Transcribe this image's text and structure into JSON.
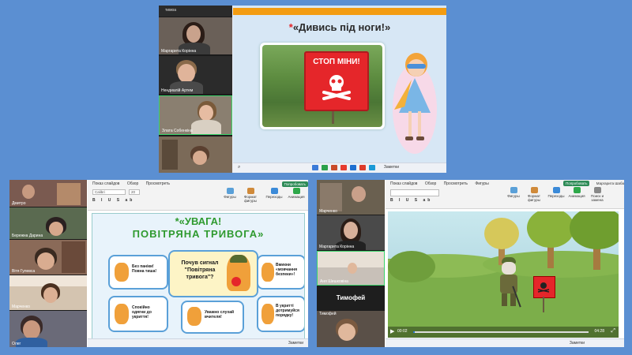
{
  "top_window": {
    "participants": [
      {
        "name": "Маргарита Корінна"
      },
      {
        "name": "Нендиалій Артем"
      },
      {
        "name": "Злата Собенкіна"
      },
      {
        "name": ""
      }
    ],
    "header_name": "тимоа",
    "slide": {
      "title_star": "*",
      "title": "«Дивись під ноги!»",
      "sign_text": "СТОП МІНИ!"
    },
    "notes_label": "Заметки",
    "colors": {
      "orange_bar": "#f39c12",
      "sign_red": "#e5262a"
    }
  },
  "bottom_left_window": {
    "participants": [
      {
        "name": "Дмитро"
      },
      {
        "name": "Бережна Дарина"
      },
      {
        "name": "Вітя Гулевса"
      },
      {
        "name": "Марченко"
      },
      {
        "name": "Олег"
      }
    ],
    "ribbon": {
      "menu": [
        "Показ слайдов",
        "Обзор",
        "Просмотреть"
      ],
      "tools": [
        "Фигуры",
        "Формат фигуры",
        "Переходы",
        "Анимация"
      ],
      "font": "Calibri",
      "font_size": "20",
      "badge": "Попробовать"
    },
    "slide": {
      "title_line1": "*«УВАГА!",
      "title_line2": "ПОВІТРЯНА ТРИВОГА»",
      "center_card": "Почув сигнал \"Повітряна тривога\"?",
      "cards": [
        "Без паніки! Повна тиша!",
        "Вмикни «мовчання безпеки»!",
        "Спокійно одягни до укриття!",
        "Уважно слухай вчителя!",
        "В укритті дотримуйся порядку!"
      ]
    },
    "notes_label": "Заметки"
  },
  "bottom_right_window": {
    "participants": [
      {
        "name": "Марченко"
      },
      {
        "name": "Маргарита Корінна"
      },
      {
        "name": "Аня Шишковіна"
      },
      {
        "name": "Тимофей"
      },
      {
        "name": "Тимофей"
      }
    ],
    "big_name": "Тимофей",
    "ribbon": {
      "menu": [
        "Показ слайдов",
        "Обзор",
        "Просмотреть",
        "Фигуры"
      ],
      "tools": [
        "Фигуры",
        "Формат фигуры",
        "Переходы",
        "Анимация",
        "Поиск и замена"
      ],
      "badge": "Попробовать",
      "user": "Маргарита Шаба"
    },
    "video": {
      "time_elapsed": "00:02",
      "time_total": "04:28",
      "sign_text": "!"
    },
    "notes_label": "Заметки"
  }
}
